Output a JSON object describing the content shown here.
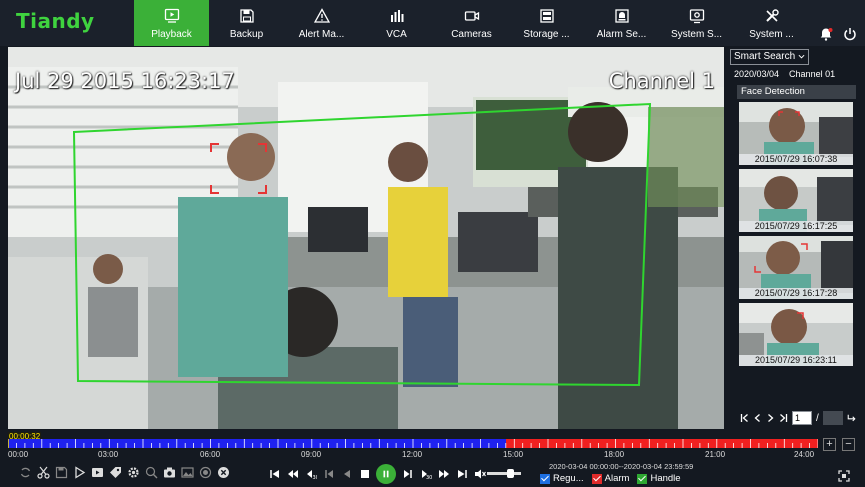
{
  "app": {
    "logo": "Tiandy"
  },
  "nav": [
    {
      "label": "Playback",
      "icon": "playback-icon",
      "active": true
    },
    {
      "label": "Backup",
      "icon": "save-icon"
    },
    {
      "label": "Alert Ma...",
      "icon": "alert-icon"
    },
    {
      "label": "VCA",
      "icon": "chart-icon"
    },
    {
      "label": "Cameras",
      "icon": "camera-icon"
    },
    {
      "label": "Storage ...",
      "icon": "storage-icon"
    },
    {
      "label": "Alarm Se...",
      "icon": "alarm-settings-icon"
    },
    {
      "label": "System S...",
      "icon": "system-settings-icon"
    },
    {
      "label": "System ...",
      "icon": "tools-icon"
    }
  ],
  "video": {
    "osd_time": "Jul 29 2015 16:23:17",
    "osd_channel": "Channel 1"
  },
  "side": {
    "search_mode": "Smart Search",
    "date": "2020/03/04",
    "channel": "Channel 01",
    "header": "Face Detection",
    "results": [
      {
        "time": "2015/07/29 16:07:38"
      },
      {
        "time": "2015/07/29 16:17:25"
      },
      {
        "time": "2015/07/29 16:17:28"
      },
      {
        "time": "2015/07/29 16:23:11"
      }
    ],
    "page_current": "1",
    "page_separator": "/"
  },
  "timeline": {
    "current": "00:00:32",
    "labels": [
      "00:00",
      "03:00",
      "06:00",
      "09:00",
      "12:00",
      "15:00",
      "18:00",
      "21:00",
      "24:00"
    ],
    "colors": {
      "regular": "#1f22f0",
      "alarm": "#f02020"
    }
  },
  "zoom": {
    "in": "+",
    "out": "−"
  },
  "footer": {
    "range": "2020-03-04 00:00:00--2020-03-04 23:59:59",
    "legend": [
      {
        "label": "Regu...",
        "color": "#1d6fe0"
      },
      {
        "label": "Alarm",
        "color": "#e02a2a"
      },
      {
        "label": "Handle",
        "color": "#2ea832"
      }
    ]
  },
  "colors": {
    "accent": "#3bb038",
    "brand": "#3fd33f",
    "detection_box": "#2fd52f"
  }
}
